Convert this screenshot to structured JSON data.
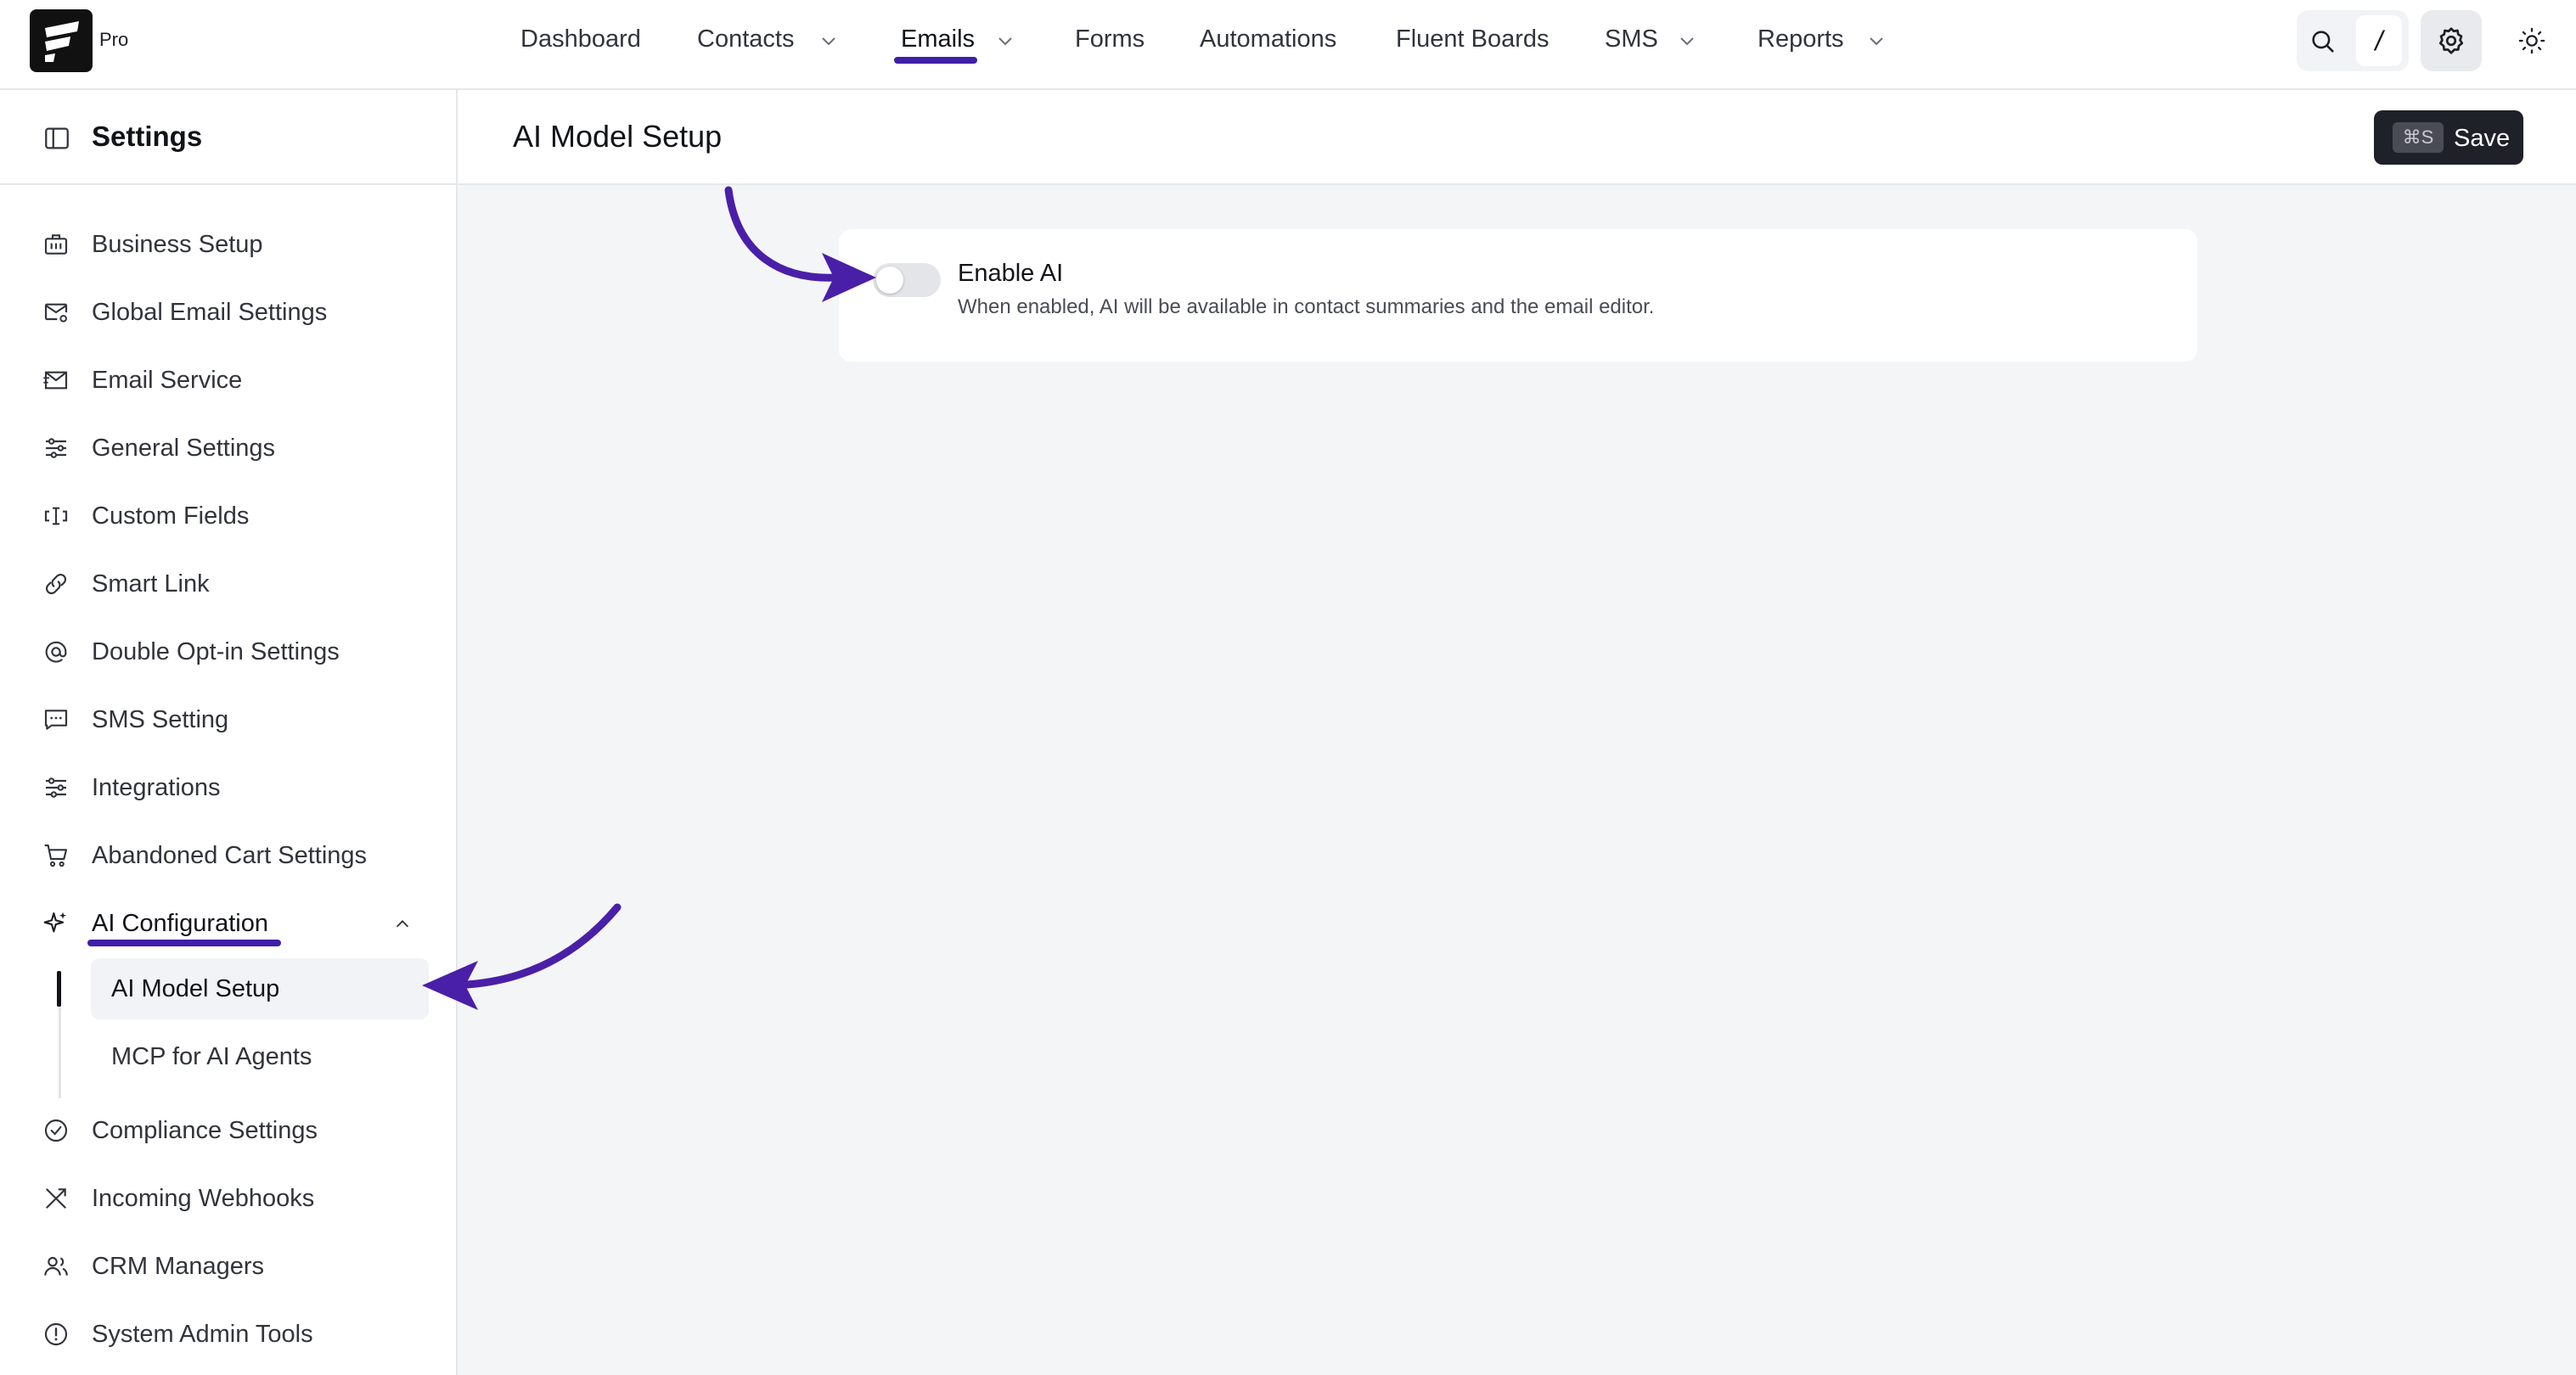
{
  "brand": {
    "badge": "Pro"
  },
  "nav": {
    "items": [
      {
        "label": "Dashboard",
        "has_dropdown": false
      },
      {
        "label": "Contacts",
        "has_dropdown": true
      },
      {
        "label": "Emails",
        "has_dropdown": true,
        "active": true
      },
      {
        "label": "Forms",
        "has_dropdown": false
      },
      {
        "label": "Automations",
        "has_dropdown": false
      },
      {
        "label": "Fluent Boards",
        "has_dropdown": false
      },
      {
        "label": "SMS",
        "has_dropdown": true
      },
      {
        "label": "Reports",
        "has_dropdown": true
      }
    ],
    "search_shortcut": "/"
  },
  "sidebar": {
    "title": "Settings",
    "items": [
      {
        "label": "Business Setup",
        "icon": "building-icon"
      },
      {
        "label": "Global Email Settings",
        "icon": "mail-settings-icon"
      },
      {
        "label": "Email Service",
        "icon": "mail-send-icon"
      },
      {
        "label": "General Settings",
        "icon": "sliders-icon"
      },
      {
        "label": "Custom Fields",
        "icon": "text-cursor-icon"
      },
      {
        "label": "Smart Link",
        "icon": "link-icon"
      },
      {
        "label": "Double Opt-in Settings",
        "icon": "at-sign-icon"
      },
      {
        "label": "SMS Setting",
        "icon": "message-icon"
      },
      {
        "label": "Integrations",
        "icon": "sliders-icon"
      },
      {
        "label": "Abandoned Cart Settings",
        "icon": "cart-icon"
      },
      {
        "label": "AI Configuration",
        "icon": "sparkles-icon",
        "expanded": true
      },
      {
        "label": "Compliance Settings",
        "icon": "check-circle-icon"
      },
      {
        "label": "Incoming Webhooks",
        "icon": "webhook-icon"
      },
      {
        "label": "CRM Managers",
        "icon": "users-icon"
      },
      {
        "label": "System Admin Tools",
        "icon": "alert-circle-icon"
      }
    ],
    "sub_items": [
      {
        "label": "AI Model Setup",
        "active": true
      },
      {
        "label": "MCP for AI Agents",
        "active": false
      }
    ]
  },
  "main": {
    "title": "AI Model Setup",
    "save": {
      "shortcut": "⌘S",
      "label": "Save"
    },
    "enable_ai": {
      "label": "Enable AI",
      "description": "When enabled, AI will be available in contact summaries and the email editor.",
      "enabled": false
    }
  },
  "colors": {
    "accent": "#3f1ea8",
    "annotation": "#4a1fa8",
    "save_bg": "#1f2128",
    "main_bg": "#f4f5f7"
  }
}
